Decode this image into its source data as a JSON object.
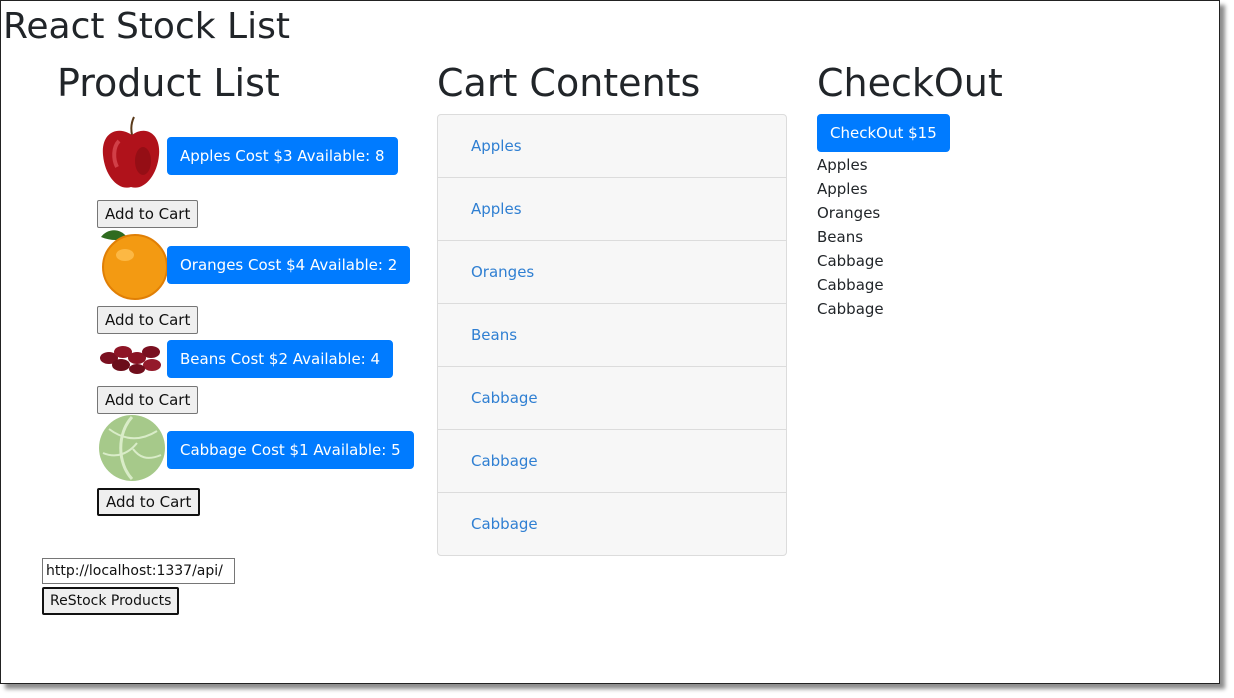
{
  "app": {
    "title": "React Stock List"
  },
  "columns": {
    "products_title": "Product List",
    "cart_title": "Cart Contents",
    "checkout_title": "CheckOut"
  },
  "products": [
    {
      "name": "Apples",
      "label": "Apples Cost $3 Available: 8",
      "add_label": "Add to Cart",
      "image": "apple-image"
    },
    {
      "name": "Oranges",
      "label": "Oranges Cost $4 Available: 2",
      "add_label": "Add to Cart",
      "image": "orange-image"
    },
    {
      "name": "Beans",
      "label": "Beans Cost $2 Available: 4",
      "add_label": "Add to Cart",
      "image": "beans-image"
    },
    {
      "name": "Cabbage",
      "label": "Cabbage Cost $1 Available: 5",
      "add_label": "Add to Cart",
      "image": "cabbage-image"
    }
  ],
  "cart": {
    "items": [
      "Apples",
      "Apples",
      "Oranges",
      "Beans",
      "Cabbage",
      "Cabbage",
      "Cabbage"
    ]
  },
  "checkout": {
    "button_label": "CheckOut $15",
    "items": [
      "Apples",
      "Apples",
      "Oranges",
      "Beans",
      "Cabbage",
      "Cabbage",
      "Cabbage"
    ]
  },
  "restock": {
    "url_value": "http://localhost:1337/api/",
    "button_label": "ReStock Products"
  },
  "colors": {
    "primary": "#007bff",
    "link": "#2f7fd2",
    "cart_bg": "#f7f7f7"
  }
}
